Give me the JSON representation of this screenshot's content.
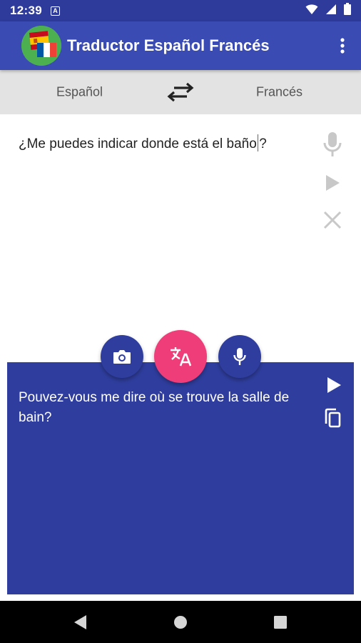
{
  "status_bar": {
    "time": "12:39",
    "notification_badge": "A",
    "icons": [
      "wifi-icon",
      "signal-icon",
      "battery-icon"
    ]
  },
  "app_bar": {
    "title": "Traductor Español Francés",
    "logo": "spain-france-flags-logo",
    "menu_icon": "more-vert-icon"
  },
  "language_bar": {
    "source_language": "Español",
    "target_language": "Francés",
    "swap_icon": "swap-arrows-icon"
  },
  "input": {
    "text": "¿Me puedes indicar donde está el baño?",
    "actions": [
      "microphone-icon",
      "play-icon",
      "clear-icon"
    ]
  },
  "output": {
    "text": "Pouvez-vous me dire où se trouve la salle de bain?",
    "actions": [
      "play-icon",
      "copy-icon"
    ]
  },
  "fabs": [
    "camera-icon",
    "translate-icon",
    "microphone-icon"
  ],
  "nav_bar": [
    "back-icon",
    "home-icon",
    "recents-icon"
  ],
  "colors": {
    "primary": "#3a4bb4",
    "primary_dark": "#2f3b9a",
    "output_bg": "#2f3e9e",
    "accent": "#ef3d7a",
    "lang_bar_bg": "#e3e3e3"
  }
}
